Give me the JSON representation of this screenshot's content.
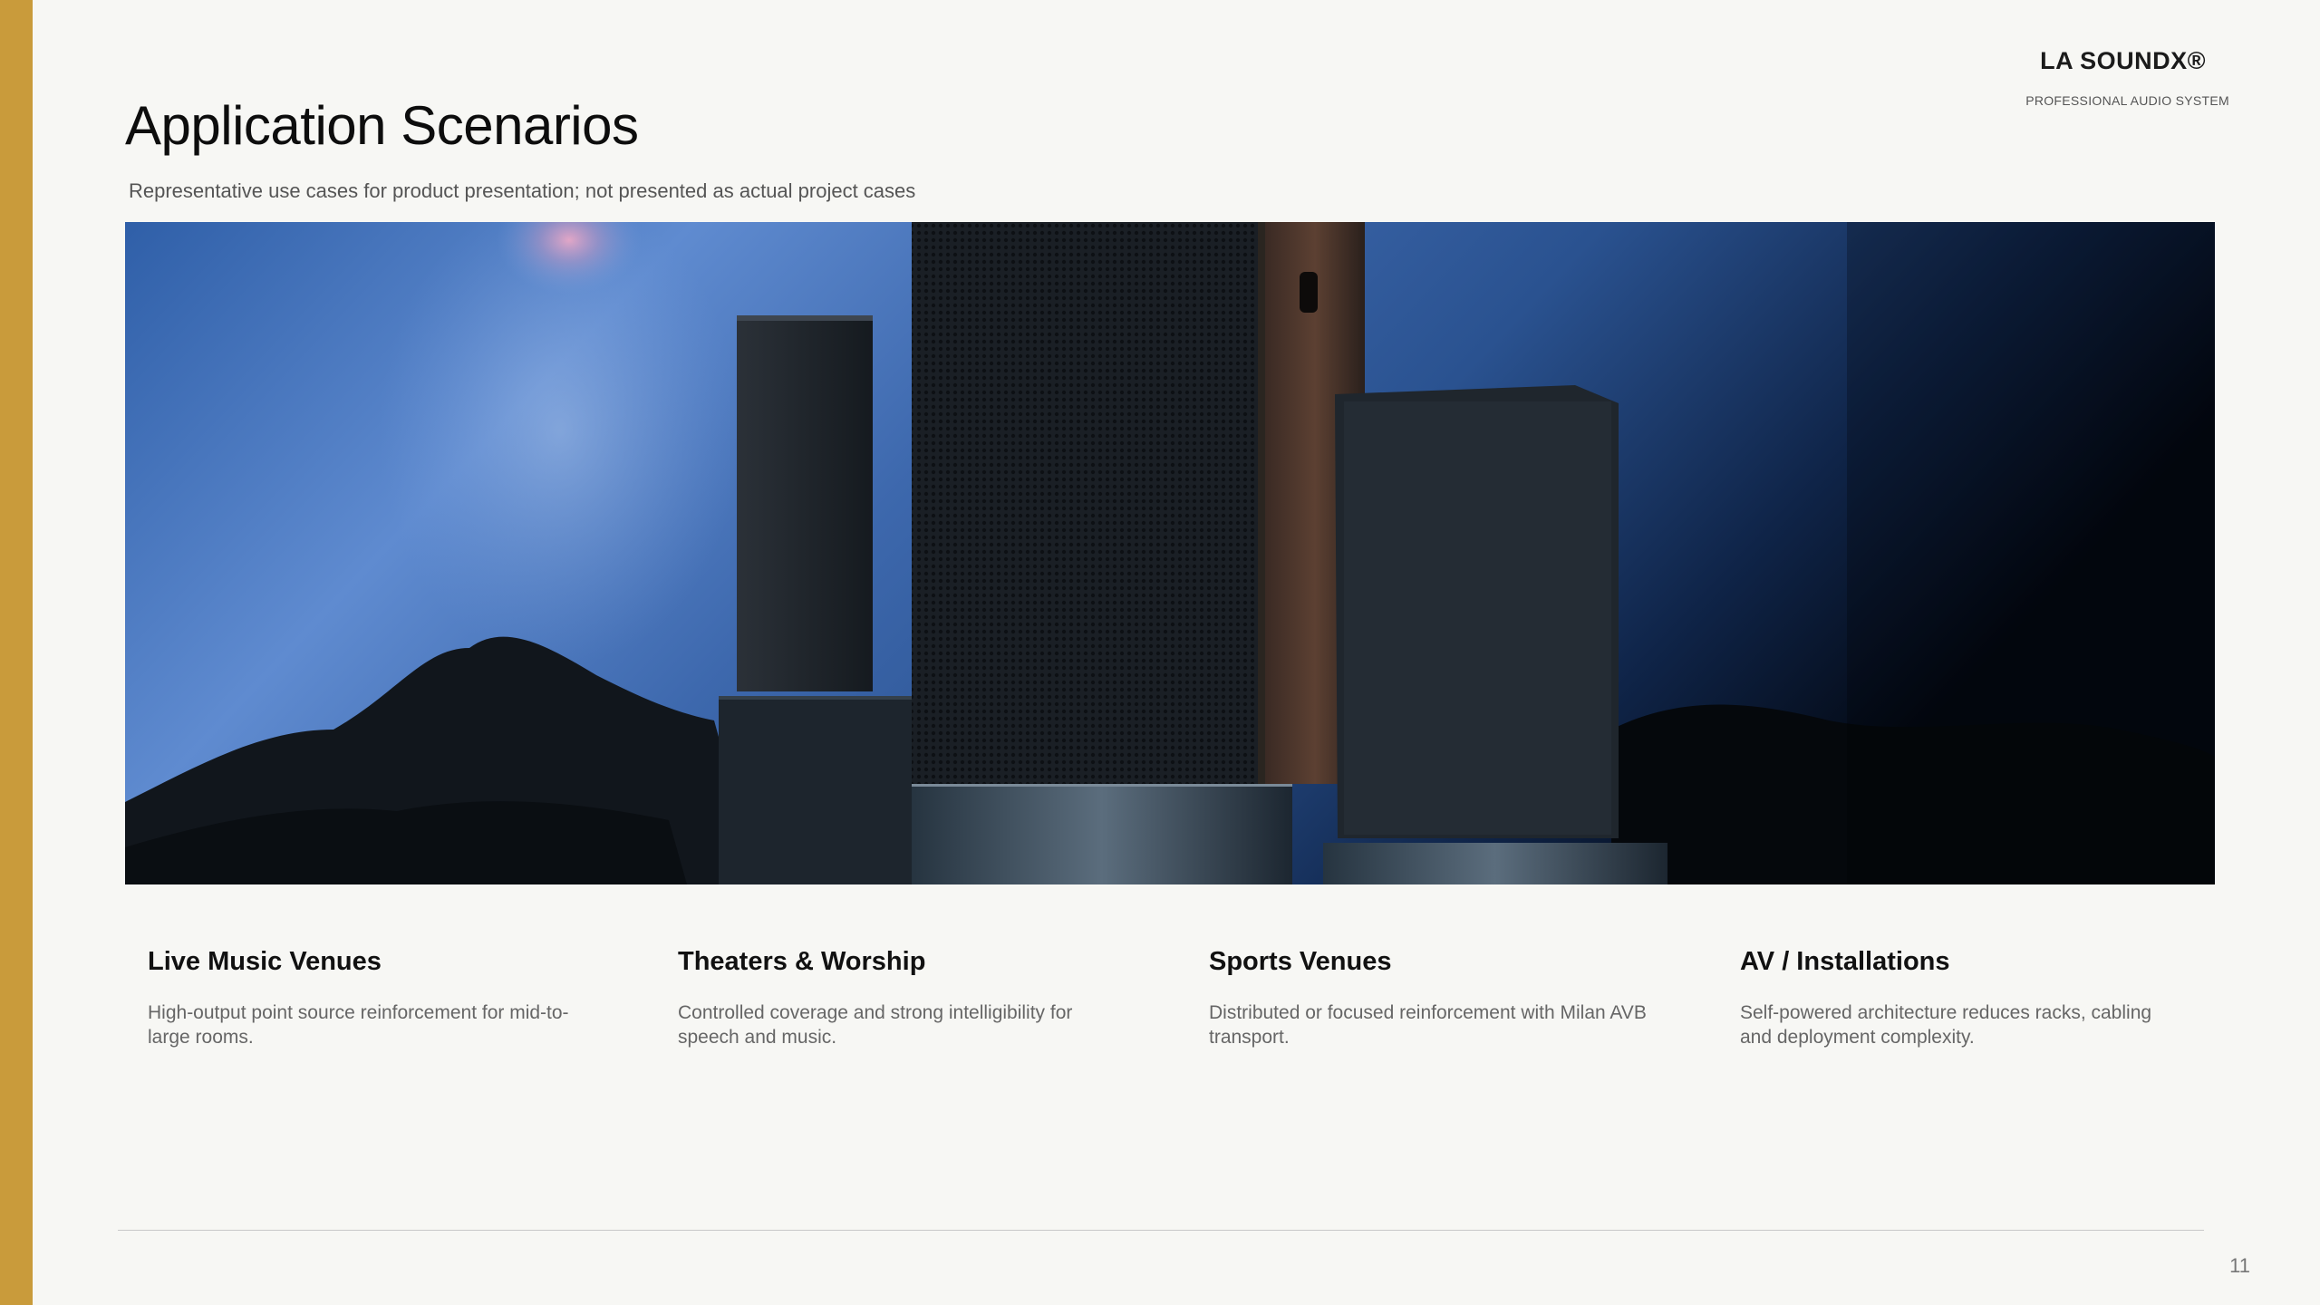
{
  "brand": {
    "name": "LA SOUNDX®",
    "tagline": "PROFESSIONAL AUDIO SYSTEM"
  },
  "slide": {
    "title": "Application Scenarios",
    "subtitle": "Representative use cases for product presentation; not presented as actual project cases",
    "page_number": "11"
  },
  "hero_image": {
    "subject": "speaker-cabinets-at-dusk"
  },
  "scenarios": [
    {
      "title": "Live Music Venues",
      "description": "High-output point source reinforcement for mid-to-large rooms."
    },
    {
      "title": "Theaters & Worship",
      "description": "Controlled coverage and strong intelligibility for speech and music."
    },
    {
      "title": "Sports Venues",
      "description": "Distributed or focused reinforcement with Milan AVB transport."
    },
    {
      "title": "AV / Installations",
      "description": "Self-powered architecture reduces racks, cabling and deployment complexity."
    }
  ],
  "colors": {
    "accent": "#c99b3b",
    "background": "#f7f7f4"
  }
}
